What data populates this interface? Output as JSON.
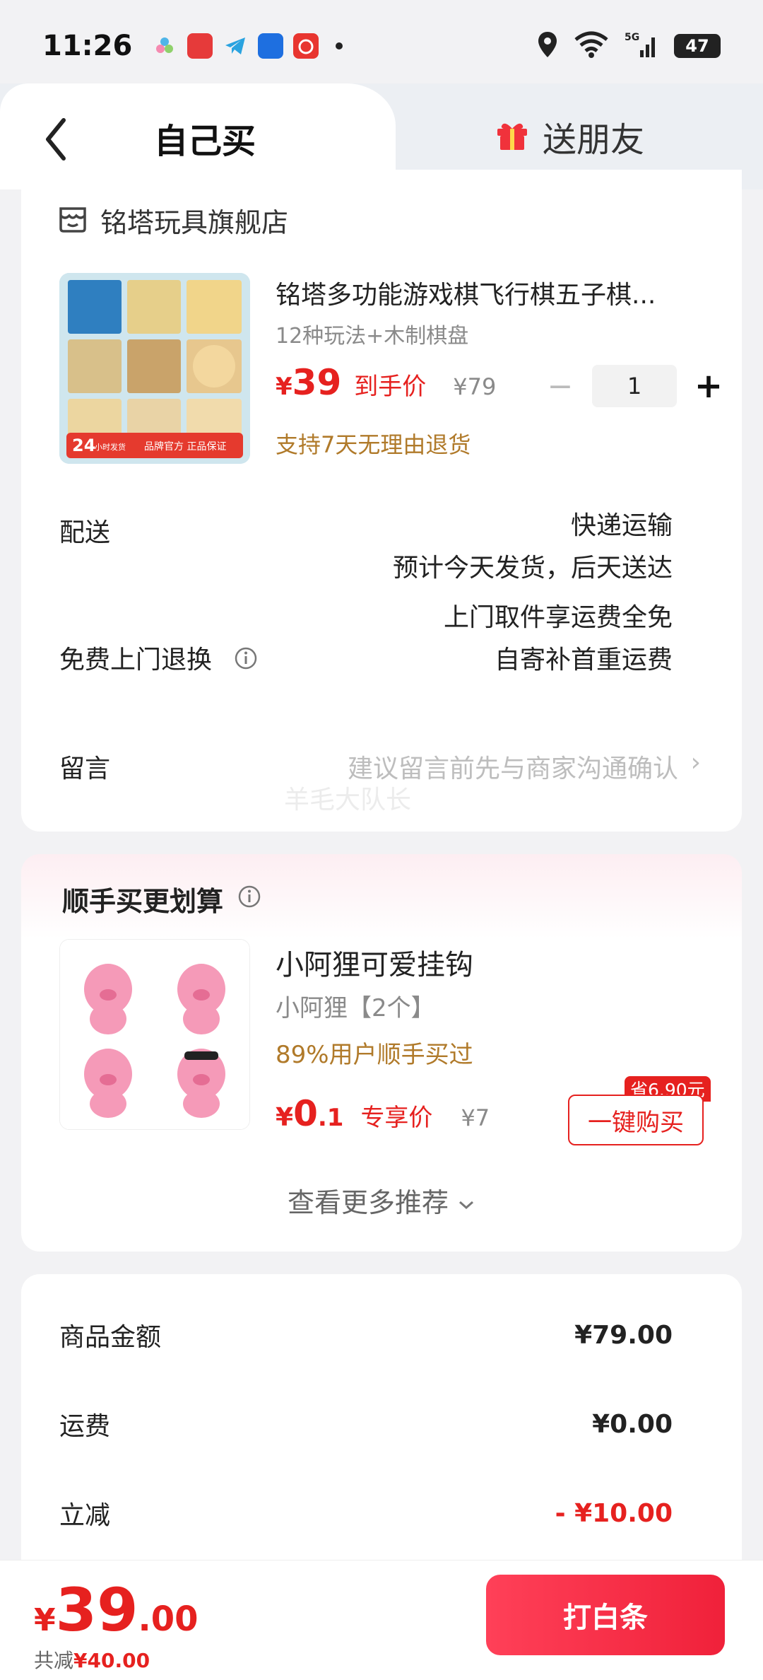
{
  "status_bar": {
    "time": "11:26",
    "battery": "47",
    "network": "5G"
  },
  "tabs": {
    "self_buy": "自己买",
    "gift_friend": "送朋友"
  },
  "store": {
    "name": "铭塔玩具旗舰店"
  },
  "product": {
    "title": "铭塔多功能游戏棋飞行棋五子棋...",
    "spec": "12种玩法+木制棋盘",
    "price_symbol": "¥",
    "price": "39",
    "price_tag": "到手价",
    "original_price": "¥79",
    "quantity": "1",
    "return_policy": "支持7天无理由退货",
    "image_badge_hours": "24",
    "image_badge_text": "小时发货",
    "image_badge_brand": "品牌官方 正品保证"
  },
  "delivery": {
    "label": "配送",
    "method": "快递运输",
    "eta": "预计今天发货，后天送达"
  },
  "returns": {
    "label": "免费上门退换",
    "line1": "上门取件享运费全免",
    "line2": "自寄补首重运费"
  },
  "memo": {
    "label": "留言",
    "placeholder": "建议留言前先与商家沟通确认",
    "watermark": "羊毛大队长"
  },
  "recommend": {
    "title": "顺手买更划算",
    "item_name": "小阿狸可爱挂钩",
    "item_spec": "小阿狸【2个】",
    "social_proof": "89%用户顺手买过",
    "price_symbol": "¥",
    "price_int": "0",
    "price_dec": ".1",
    "price_tag": "专享价",
    "original_price": "¥7",
    "save_badge": "省6.90元",
    "buy_button": "一键购买",
    "more_link": "查看更多推荐"
  },
  "summary": {
    "goods_label": "商品金额",
    "goods_value": "¥79.00",
    "shipping_label": "运费",
    "shipping_value": "¥0.00",
    "discount_label": "立减",
    "discount_value": "- ¥10.00"
  },
  "footer": {
    "total_symbol": "¥",
    "total_int": "39",
    "total_dec": ".00",
    "saved_prefix": "共减",
    "saved_value": "¥40.00",
    "pay_button": "打白条"
  },
  "colors": {
    "accent_red": "#e6211f",
    "note_gold": "#b07a2a",
    "pay_gradient_start": "#ff4058"
  }
}
